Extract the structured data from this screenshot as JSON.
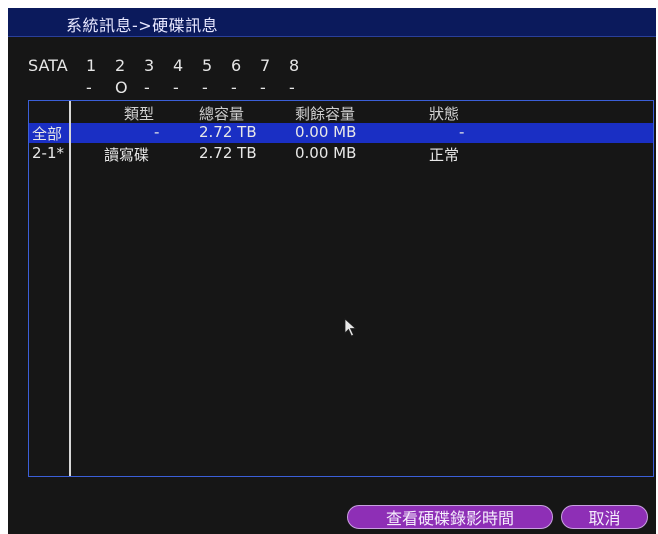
{
  "window": {
    "title": "系統訊息->硬碟訊息"
  },
  "sata": {
    "label": "SATA",
    "ports": [
      "1",
      "2",
      "3",
      "4",
      "5",
      "6",
      "7",
      "8"
    ],
    "status": [
      "-",
      "O",
      "-",
      "-",
      "-",
      "-",
      "-",
      "-"
    ]
  },
  "table": {
    "headers": [
      "類型",
      "總容量",
      "剩餘容量",
      "狀態"
    ],
    "rows": [
      {
        "id": "全部",
        "type": "-",
        "total": "2.72 TB",
        "free": "0.00 MB",
        "status": "-"
      },
      {
        "id": "2-1*",
        "type": "讀寫碟",
        "total": "2.72 TB",
        "free": "0.00 MB",
        "status": "正常"
      }
    ],
    "selected_row": 0
  },
  "buttons": {
    "view_record_time": "查看硬碟錄影時間",
    "cancel": "取消"
  },
  "colors": {
    "title_bg": "#0b1a5c",
    "selection": "#1a2fc4",
    "button": "#8e2fb6",
    "panel_bg": "#161616"
  },
  "icons": {
    "cursor": "mouse-pointer-icon"
  }
}
